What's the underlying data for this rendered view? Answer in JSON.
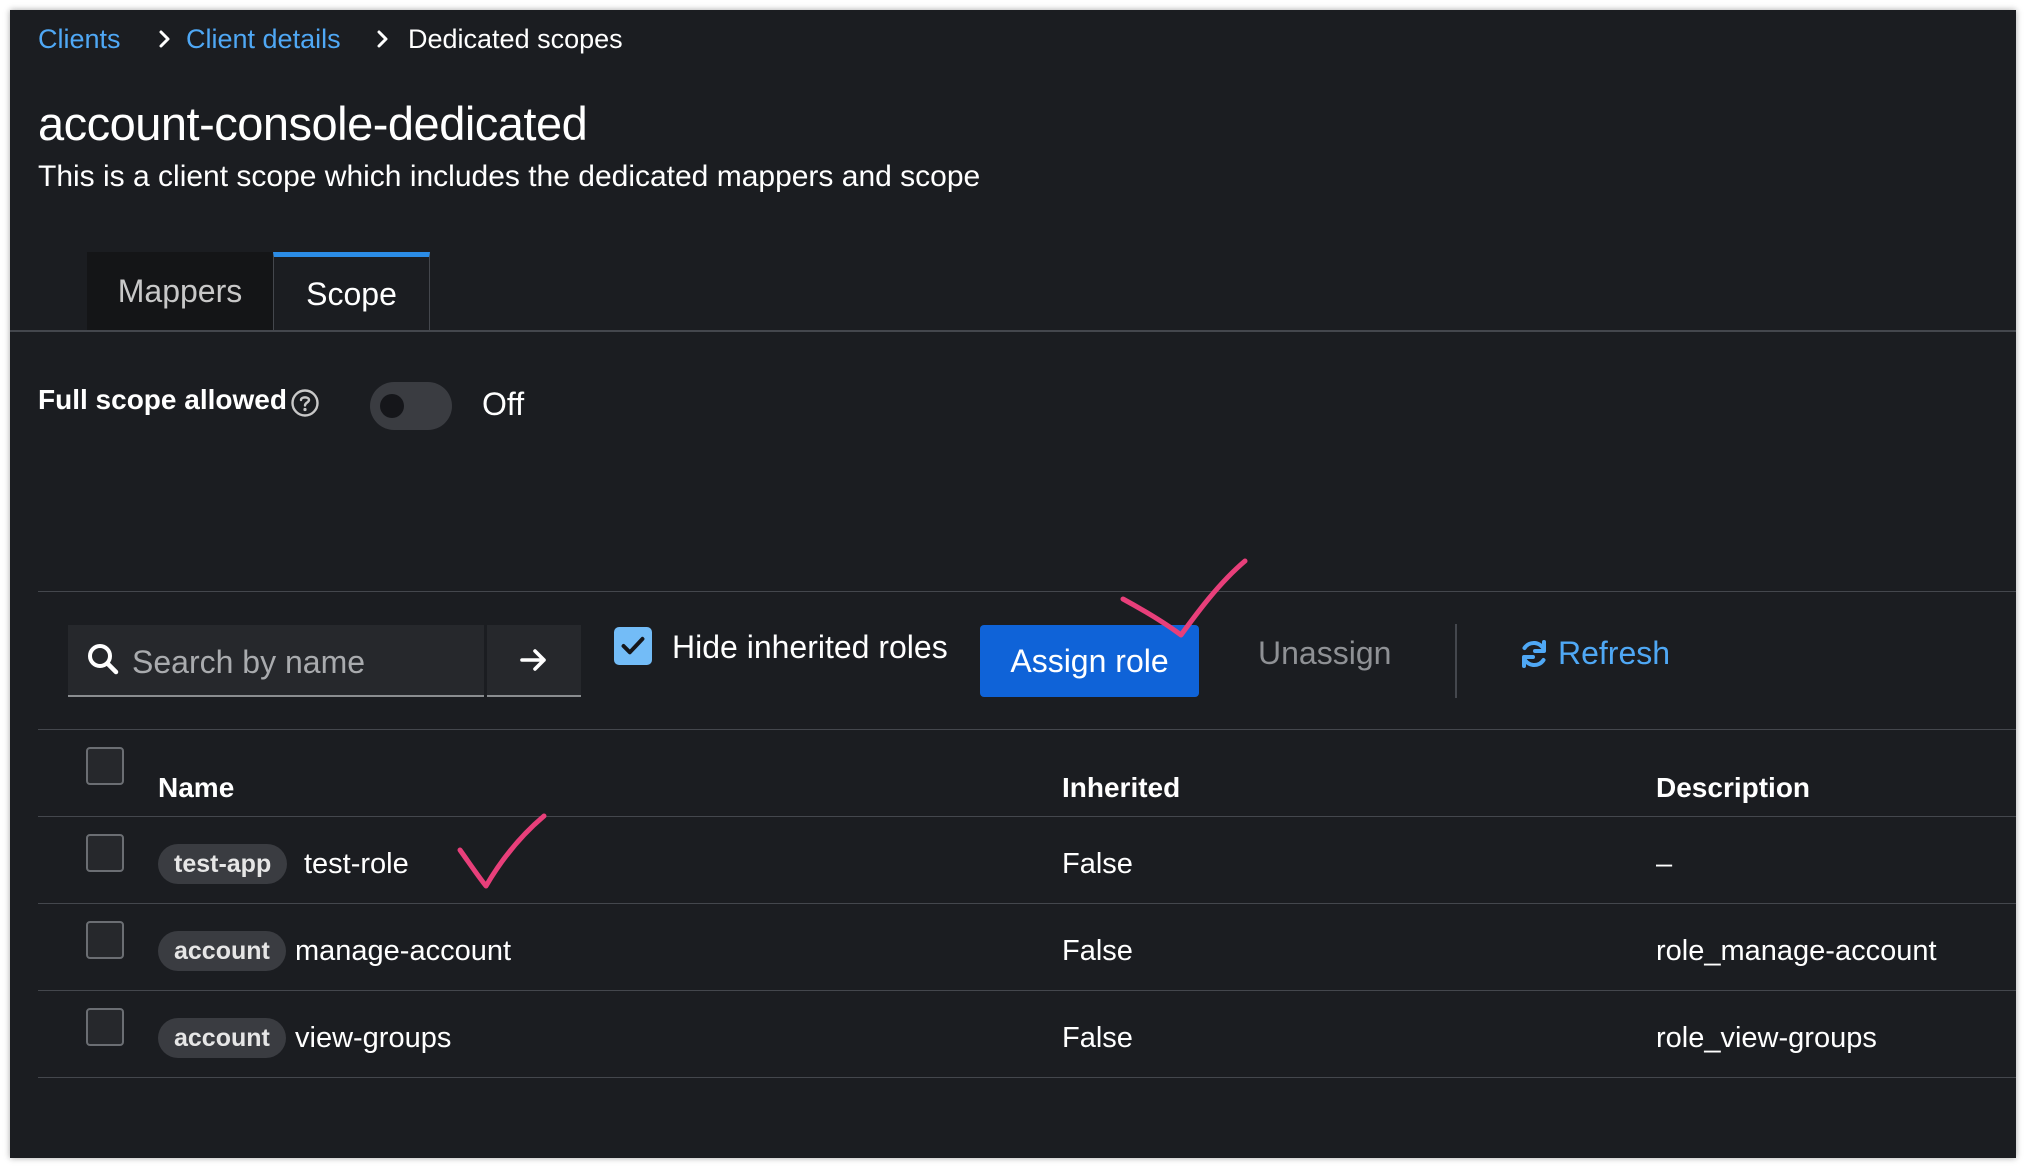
{
  "breadcrumb": {
    "items": [
      {
        "label": "Clients"
      },
      {
        "label": "Client details"
      },
      {
        "label": "Dedicated scopes"
      }
    ]
  },
  "page": {
    "title": "account-console-dedicated",
    "subtitle": "This is a client scope which includes the dedicated mappers and scope"
  },
  "tabs": [
    {
      "label": "Mappers",
      "active": false
    },
    {
      "label": "Scope",
      "active": true
    }
  ],
  "full_scope": {
    "label": "Full scope allowed",
    "state": "Off"
  },
  "toolbar": {
    "search_placeholder": "Search by name",
    "search_value": "",
    "hide_inherited_label": "Hide inherited roles",
    "hide_inherited_checked": true,
    "assign_label": "Assign role",
    "unassign_label": "Unassign",
    "refresh_label": "Refresh"
  },
  "table": {
    "columns": [
      "Name",
      "Inherited",
      "Description"
    ],
    "rows": [
      {
        "client": "test-app",
        "role": "test-role",
        "inherited": "False",
        "description": "–"
      },
      {
        "client": "account",
        "role": "manage-account",
        "inherited": "False",
        "description": "role_manage-account"
      },
      {
        "client": "account",
        "role": "view-groups",
        "inherited": "False",
        "description": "role_view-groups"
      }
    ]
  },
  "colors": {
    "background": "#1b1d21",
    "link": "#4fa8f5",
    "primary_button": "#0f63d8",
    "active_tab_border": "#2b8ce6",
    "annotation_check": "#e83f7a"
  },
  "icons": [
    "chevron-right-icon",
    "help-icon",
    "search-icon",
    "arrow-right-icon",
    "check-icon",
    "refresh-icon",
    "annotation-checkmark"
  ]
}
